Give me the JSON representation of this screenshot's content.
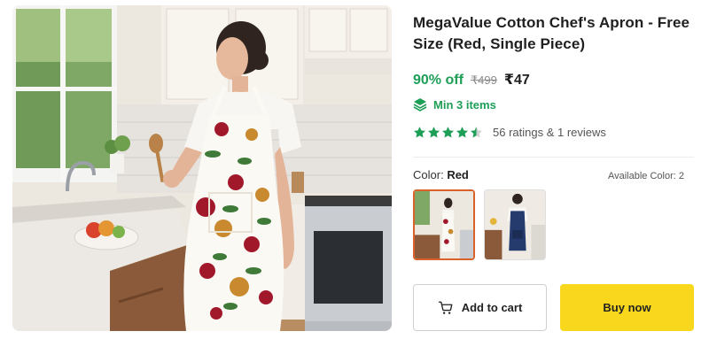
{
  "product": {
    "title": "MegaValue Cotton Chef's Apron - Free Size (Red, Single Piece)",
    "discount": "90% off",
    "mrp": "₹499",
    "price": "₹47",
    "min_order": "Min 3 items",
    "rating_stars": 4.5,
    "rating_text": "56 ratings & 1 reviews"
  },
  "color": {
    "label": "Color:",
    "selected": "Red",
    "available_text": "Available Color: 2"
  },
  "actions": {
    "add_to_cart": "Add to cart",
    "buy_now": "Buy now"
  },
  "colors": {
    "green": "#1e9e57",
    "accent_border": "#d9622b",
    "buy_button": "#f9d71c"
  },
  "icons": {
    "min_order": "layers-icon",
    "cart": "cart-icon",
    "star": "star-icon"
  }
}
